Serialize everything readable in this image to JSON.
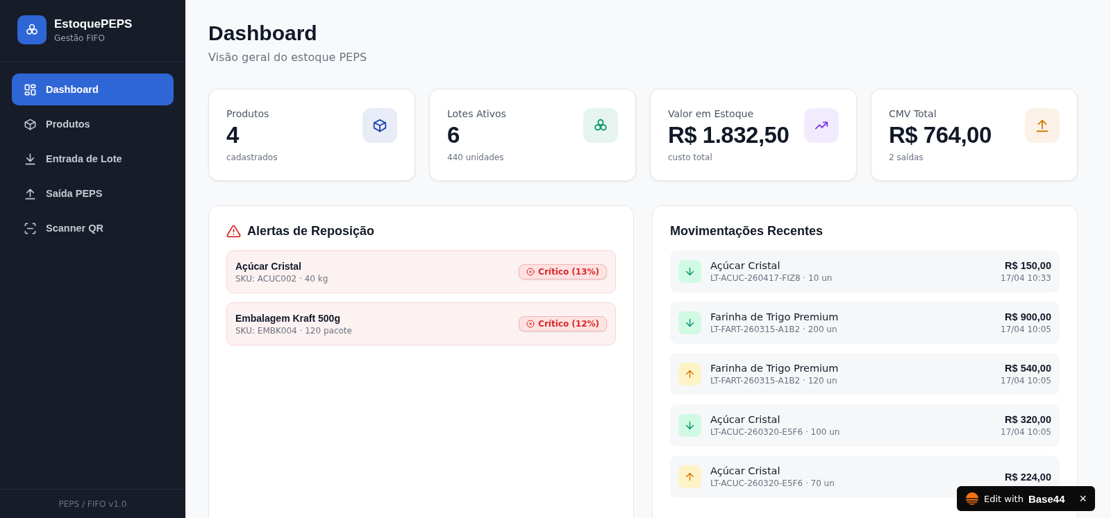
{
  "sidebar": {
    "brand": {
      "name": "EstoquePEPS",
      "subtitle": "Gestão FIFO"
    },
    "items": [
      {
        "label": "Dashboard",
        "selected": true
      },
      {
        "label": "Produtos",
        "selected": false
      },
      {
        "label": "Entrada de Lote",
        "selected": false
      },
      {
        "label": "Saída PEPS",
        "selected": false
      },
      {
        "label": "Scanner QR",
        "selected": false
      }
    ],
    "footer": "PEPS / FIFO v1.0"
  },
  "header": {
    "title": "Dashboard",
    "subtitle": "Visão geral do estoque PEPS"
  },
  "stats": [
    {
      "label": "Produtos",
      "value": "4",
      "caption": "cadastrados",
      "color": "#1e40af"
    },
    {
      "label": "Lotes Ativos",
      "value": "6",
      "caption": "440 unidades",
      "color": "#059669"
    },
    {
      "label": "Valor em Estoque",
      "value": "R$ 1.832,50",
      "caption": "custo total",
      "color": "#7c3aed"
    },
    {
      "label": "CMV Total",
      "value": "R$ 764,00",
      "caption": "2 saídas",
      "color": "#d97706"
    }
  ],
  "alerts": {
    "title": "Alertas de Reposição",
    "items": [
      {
        "name": "Açúcar Cristal",
        "detail": "SKU: ACUC002 · 40 kg",
        "badge": "Crítico (13%)"
      },
      {
        "name": "Embalagem Kraft 500g",
        "detail": "SKU: EMBK004 · 120 pacote",
        "badge": "Crítico (12%)"
      }
    ]
  },
  "movements": {
    "title": "Movimentações Recentes",
    "items": [
      {
        "kind": "in",
        "name": "Açúcar Cristal",
        "detail": "LT-ACUC-260417-FIZ8 · 10 un",
        "amount": "R$ 150,00",
        "date": "17/04 10:33"
      },
      {
        "kind": "in",
        "name": "Farinha de Trigo Premium",
        "detail": "LT-FART-260315-A1B2 · 200 un",
        "amount": "R$ 900,00",
        "date": "17/04 10:05"
      },
      {
        "kind": "out",
        "name": "Farinha de Trigo Premium",
        "detail": "LT-FART-260315-A1B2 · 120 un",
        "amount": "R$ 540,00",
        "date": "17/04 10:05"
      },
      {
        "kind": "in",
        "name": "Açúcar Cristal",
        "detail": "LT-ACUC-260320-E5F6 · 100 un",
        "amount": "R$ 320,00",
        "date": "17/04 10:05"
      },
      {
        "kind": "out",
        "name": "Açúcar Cristal",
        "detail": "LT-ACUC-260320-E5F6 · 70 un",
        "amount": "R$ 224,00"
      }
    ]
  },
  "edit_badge": {
    "prefix": "Edit with",
    "brand": "Base44",
    "close": "×"
  }
}
